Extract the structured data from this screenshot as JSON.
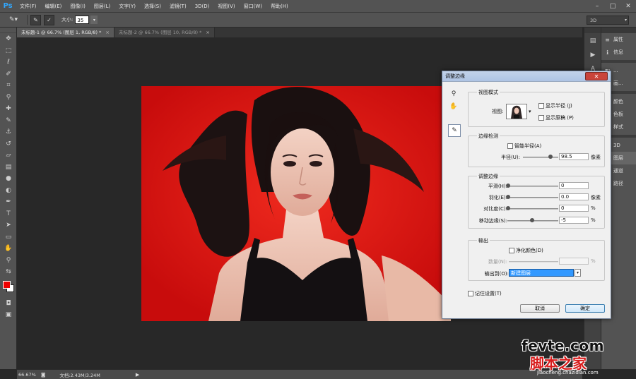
{
  "app": {
    "logo": "Ps",
    "menus": [
      "文件(F)",
      "编辑(E)",
      "图像(I)",
      "图层(L)",
      "文字(Y)",
      "选择(S)",
      "滤镜(T)",
      "3D(D)",
      "视图(V)",
      "窗口(W)",
      "帮助(H)"
    ],
    "workspace": "3D"
  },
  "options": {
    "size_label": "大小:",
    "size_value": "35"
  },
  "tabs": [
    {
      "label": "未标题-1 @ 66.7% (图层 1, RGB/8) *",
      "active": true
    },
    {
      "label": "未标题-2 @ 66.7% (图层 10, RGB/8) *",
      "active": false
    }
  ],
  "status": {
    "zoom": "66.67%",
    "doc": "文档:2.43M/3.24M"
  },
  "right_panel": {
    "items": [
      {
        "label": "属性",
        "icon": "properties-icon"
      },
      {
        "label": "信息",
        "icon": "info-icon"
      },
      {
        "label": "...",
        "icon": "adjust-icon"
      },
      {
        "label": "画...",
        "icon": "brush-icon"
      },
      {
        "label": "颜色",
        "icon": "color-icon"
      },
      {
        "label": "色板",
        "icon": "swatches-icon"
      },
      {
        "label": "样式",
        "icon": "styles-icon"
      },
      {
        "label": "3D",
        "icon": "3d-icon"
      },
      {
        "label": "图层",
        "icon": "layers-icon"
      },
      {
        "label": "通道",
        "icon": "channels-icon"
      },
      {
        "label": "路径",
        "icon": "paths-icon"
      }
    ]
  },
  "dialog": {
    "title": "调整边缘",
    "view_mode": {
      "title": "视图模式",
      "view_label": "视图:",
      "show_radius": "显示半径 (J)",
      "show_original": "显示原稿 (P)"
    },
    "edge_detection": {
      "title": "边缘检测",
      "smart_radius": "智能半径(A)",
      "radius_label": "半径(U):",
      "radius_value": "98.5",
      "radius_unit": "像素"
    },
    "adjust_edge": {
      "title": "调整边缘",
      "smooth_label": "平滑(H):",
      "smooth_value": "0",
      "feather_label": "羽化(E):",
      "feather_value": "0.0",
      "feather_unit": "像素",
      "contrast_label": "对比度(C):",
      "contrast_value": "0",
      "contrast_unit": "%",
      "shift_label": "移动边缘(S):",
      "shift_value": "-5",
      "shift_unit": "%"
    },
    "output": {
      "title": "输出",
      "decontaminate": "净化颜色(D)",
      "amount_label": "数量(N):",
      "amount_unit": "%",
      "output_to_label": "输出到(O):",
      "output_to_value": "新建图层"
    },
    "remember": "记住设置(T)",
    "cancel": "取消",
    "ok": "确定"
  },
  "watermark": {
    "line1": "fevte.com",
    "line2": "脚本之家",
    "line3": "jiaocheng.chazidian.com"
  }
}
